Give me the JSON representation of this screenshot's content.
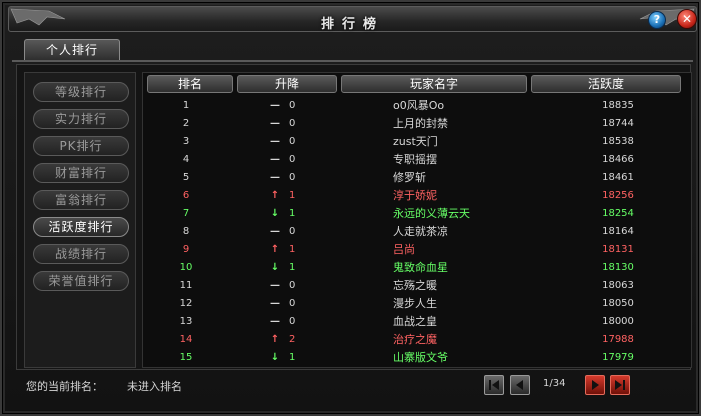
{
  "window": {
    "title": "排行榜",
    "help_label": "?",
    "close_label": "✕"
  },
  "tab": {
    "label": "个人排行"
  },
  "menu": [
    {
      "label": "等级排行",
      "active": false
    },
    {
      "label": "实力排行",
      "active": false
    },
    {
      "label": "PK排行",
      "active": false
    },
    {
      "label": "财富排行",
      "active": false
    },
    {
      "label": "富翁排行",
      "active": false
    },
    {
      "label": "活跃度排行",
      "active": true
    },
    {
      "label": "战绩排行",
      "active": false
    },
    {
      "label": "荣誉值排行",
      "active": false
    }
  ],
  "table": {
    "headers": [
      "排名",
      "升降",
      "玩家名字",
      "活跃度"
    ],
    "rows": [
      {
        "rank": "1",
        "arrow": "—",
        "change": "0",
        "name": "o0风暴Oo",
        "score": "18835",
        "color": "white"
      },
      {
        "rank": "2",
        "arrow": "—",
        "change": "0",
        "name": "上月的封禁",
        "score": "18744",
        "color": "white"
      },
      {
        "rank": "3",
        "arrow": "—",
        "change": "0",
        "name": "zust天门",
        "score": "18538",
        "color": "white"
      },
      {
        "rank": "4",
        "arrow": "—",
        "change": "0",
        "name": "专职摇摆",
        "score": "18466",
        "color": "white"
      },
      {
        "rank": "5",
        "arrow": "—",
        "change": "0",
        "name": "修罗斩",
        "score": "18461",
        "color": "white"
      },
      {
        "rank": "6",
        "arrow": "↑",
        "change": "1",
        "name": "淳于娇妮",
        "score": "18256",
        "color": "red"
      },
      {
        "rank": "7",
        "arrow": "↓",
        "change": "1",
        "name": "永远的义薄云天",
        "score": "18254",
        "color": "green"
      },
      {
        "rank": "8",
        "arrow": "—",
        "change": "0",
        "name": "人走就茶凉",
        "score": "18164",
        "color": "white"
      },
      {
        "rank": "9",
        "arrow": "↑",
        "change": "1",
        "name": "吕尚",
        "score": "18131",
        "color": "red"
      },
      {
        "rank": "10",
        "arrow": "↓",
        "change": "1",
        "name": "鬼致命血星",
        "score": "18130",
        "color": "green"
      },
      {
        "rank": "11",
        "arrow": "—",
        "change": "0",
        "name": "忘殇之暖",
        "score": "18063",
        "color": "white"
      },
      {
        "rank": "12",
        "arrow": "—",
        "change": "0",
        "name": "漫步人生",
        "score": "18050",
        "color": "white"
      },
      {
        "rank": "13",
        "arrow": "—",
        "change": "0",
        "name": "血战之皇",
        "score": "18000",
        "color": "white"
      },
      {
        "rank": "14",
        "arrow": "↑",
        "change": "2",
        "name": "治疗之魔",
        "score": "17988",
        "color": "red"
      },
      {
        "rank": "15",
        "arrow": "↓",
        "change": "1",
        "name": "山寨版文爷",
        "score": "17979",
        "color": "green"
      }
    ]
  },
  "footer": {
    "label": "您的当前排名：",
    "value": "未进入排名",
    "page": "1/34"
  },
  "pagination": {
    "first_icon": "first-page-icon",
    "prev_icon": "prev-page-icon",
    "next_icon": "next-page-icon",
    "last_icon": "last-page-icon"
  }
}
